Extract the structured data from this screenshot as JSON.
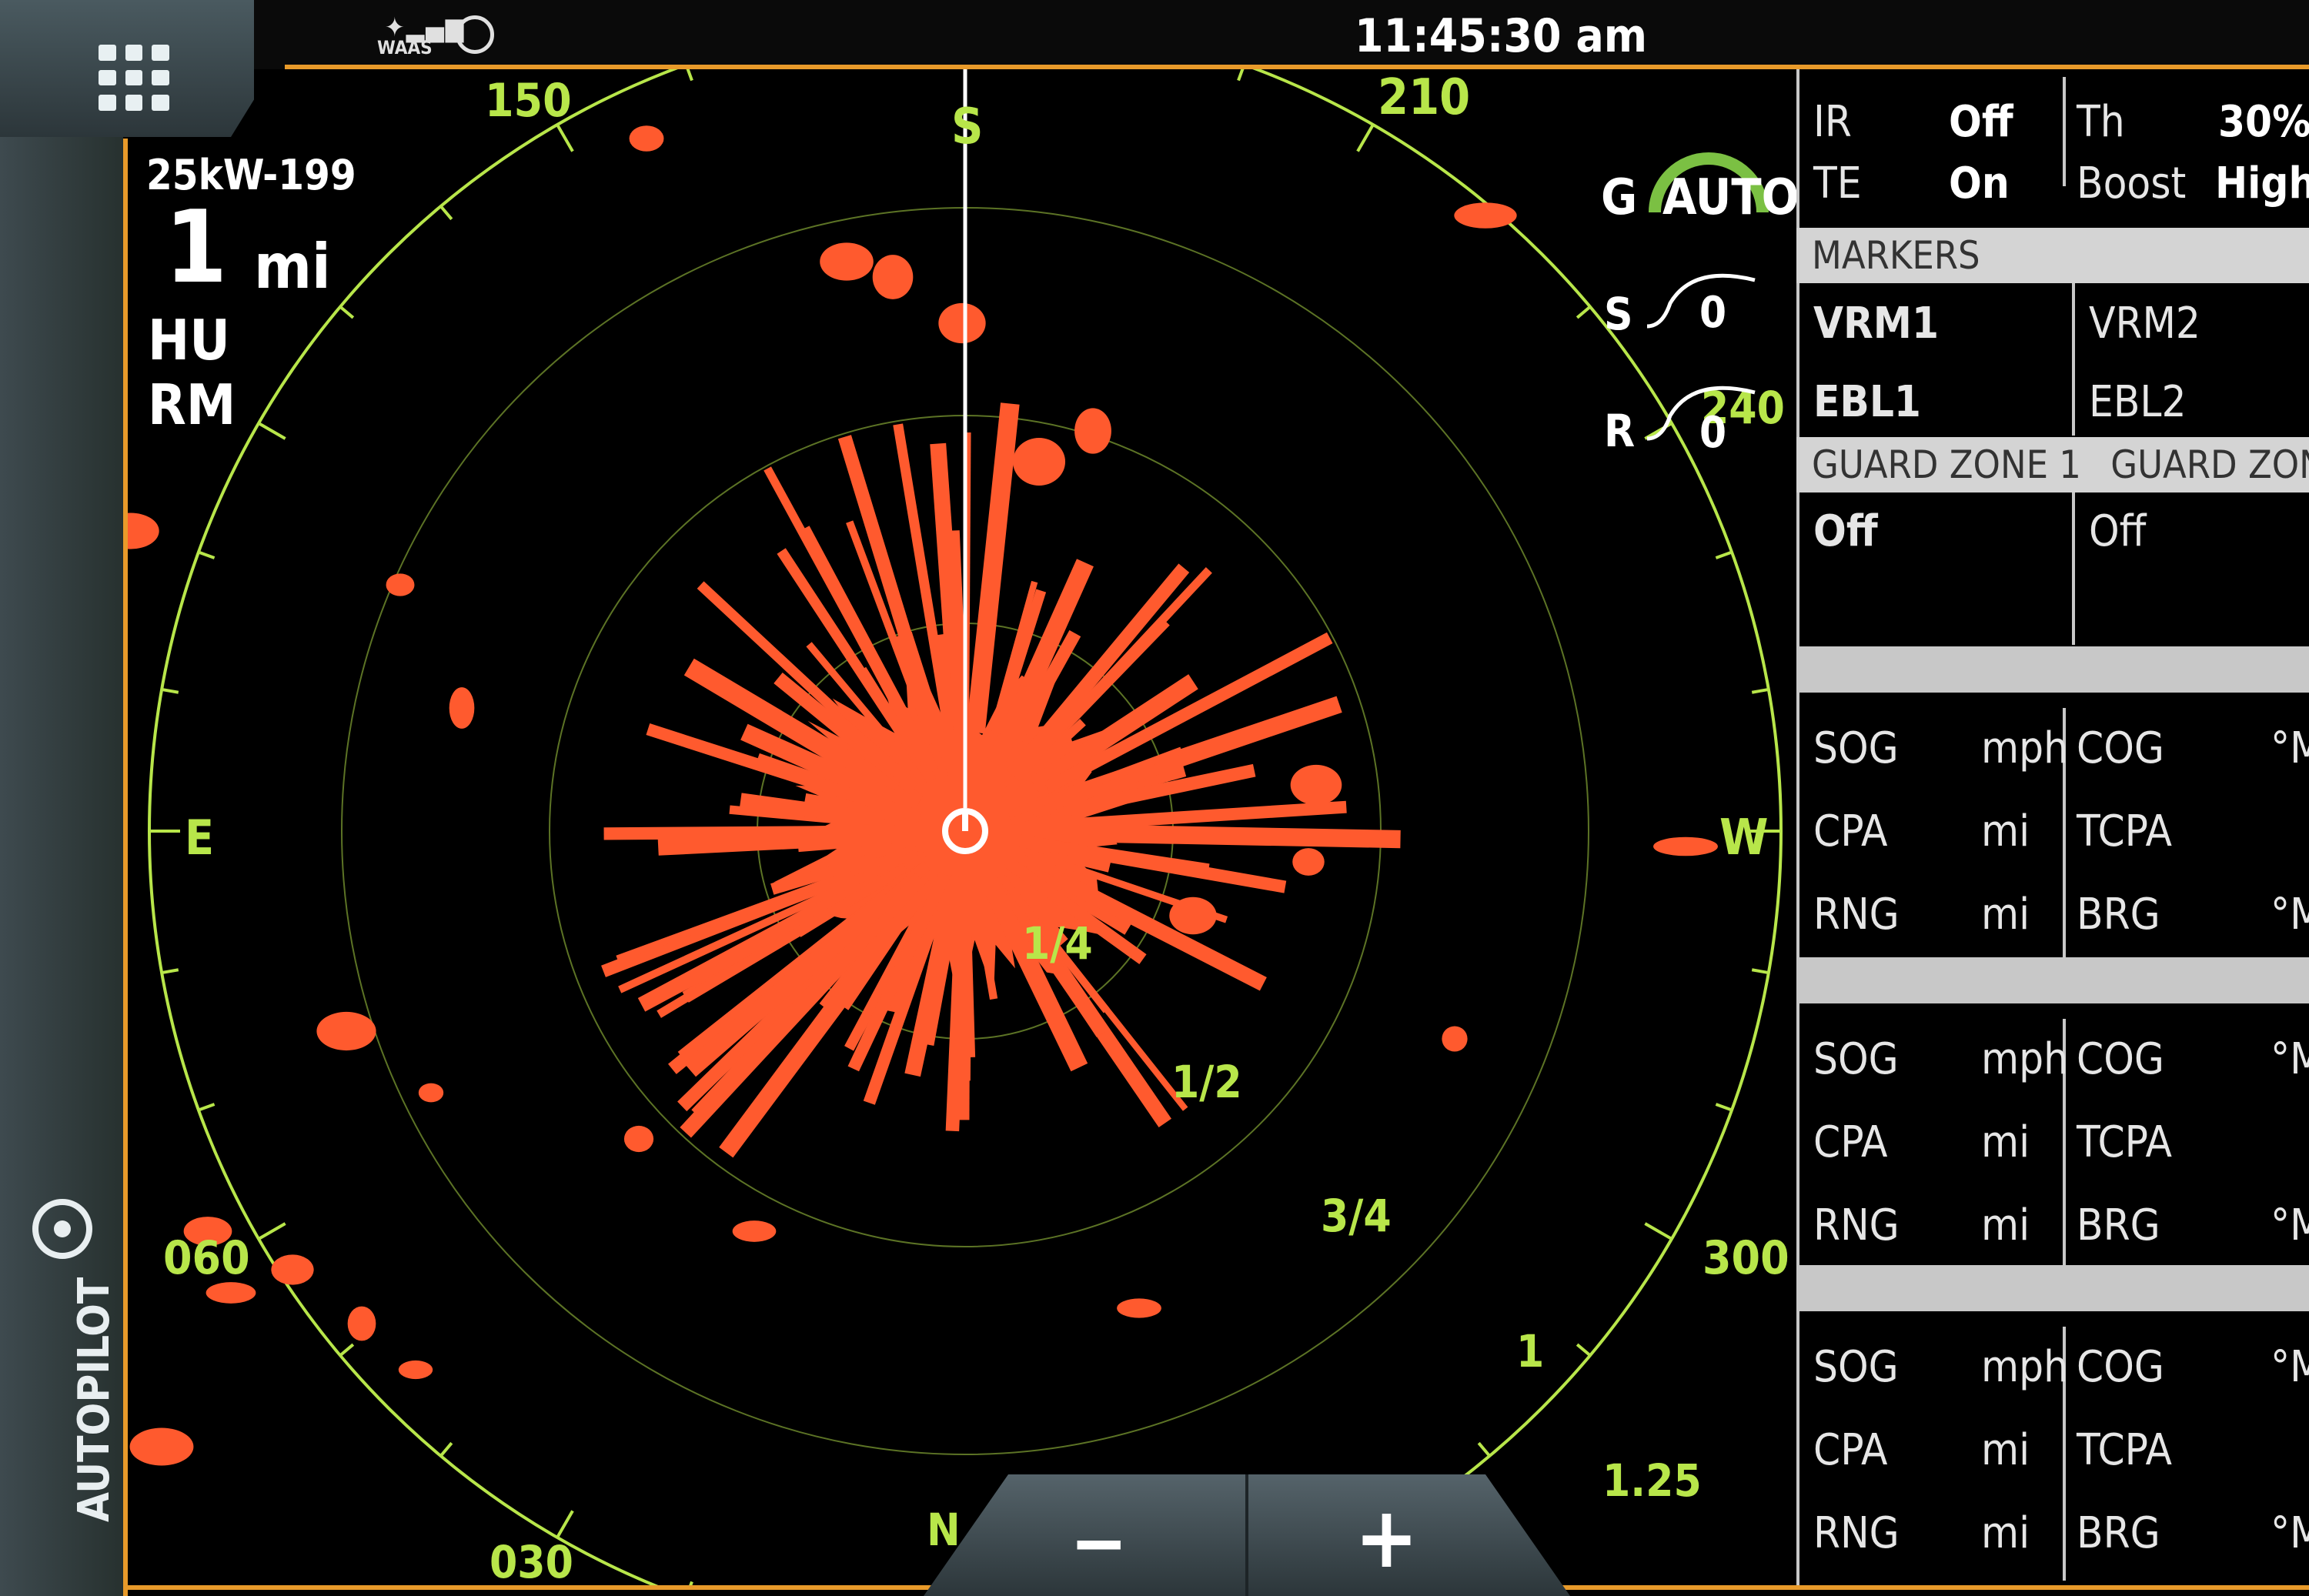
{
  "status_bar": {
    "waas_label": "WAAS",
    "time": "11:45:30 am",
    "home_icon": "grid-menu-icon",
    "gps_icon": "gps-refresh-icon"
  },
  "radar": {
    "model": "25kW-199",
    "range_value": "1",
    "range_unit": "mi",
    "orientation": "HU",
    "motion": "RM",
    "gain_label": "G",
    "gain_mode": "AUTO",
    "sea_label": "S",
    "sea_value": "0",
    "rain_label": "R",
    "rain_value": "0",
    "bearing_labels": [
      {
        "text": "150"
      },
      {
        "text": "S"
      },
      {
        "text": "210"
      },
      {
        "text": "240"
      },
      {
        "text": "W"
      },
      {
        "text": "300"
      },
      {
        "text": "E"
      },
      {
        "text": "060"
      },
      {
        "text": "030"
      },
      {
        "text": "N"
      }
    ],
    "ring_labels": [
      "1/4",
      "1/2",
      "3/4",
      "1",
      "1.25"
    ],
    "colors": {
      "echo": "#ff5a2e",
      "rings": "#b8e64a",
      "frame": "#e89a2a"
    }
  },
  "settings": {
    "ir_label": "IR",
    "ir_value": "Off",
    "th_label": "Th",
    "th_value": "30%",
    "te_label": "TE",
    "te_value": "On",
    "boost_label": "Boost",
    "boost_value": "High"
  },
  "markers": {
    "header": "MARKERS",
    "vrm1": "VRM1",
    "vrm2": "VRM2",
    "ebl1": "EBL1",
    "ebl2": "EBL2"
  },
  "guard_zones": {
    "header_1": "GUARD ZONE 1",
    "header_2": "GUARD ZONE",
    "zone1_value": "Off",
    "zone2_value": "Off"
  },
  "targets": [
    {
      "rows": [
        {
          "left_label": "SOG",
          "left_unit": "mph",
          "right_label": "COG",
          "right_unit": "°M"
        },
        {
          "left_label": "CPA",
          "left_unit": "mi",
          "right_label": "TCPA",
          "right_unit": ""
        },
        {
          "left_label": "RNG",
          "left_unit": "mi",
          "right_label": "BRG",
          "right_unit": "°M"
        }
      ]
    },
    {
      "rows": [
        {
          "left_label": "SOG",
          "left_unit": "mph",
          "right_label": "COG",
          "right_unit": "°M"
        },
        {
          "left_label": "CPA",
          "left_unit": "mi",
          "right_label": "TCPA",
          "right_unit": ""
        },
        {
          "left_label": "RNG",
          "left_unit": "mi",
          "right_label": "BRG",
          "right_unit": "°M"
        }
      ]
    },
    {
      "rows": [
        {
          "left_label": "SOG",
          "left_unit": "mph",
          "right_label": "COG",
          "right_unit": "°M"
        },
        {
          "left_label": "CPA",
          "left_unit": "mi",
          "right_label": "TCPA",
          "right_unit": ""
        },
        {
          "left_label": "RNG",
          "left_unit": "mi",
          "right_label": "BRG",
          "right_unit": "°M"
        }
      ]
    }
  ],
  "sidebar": {
    "autopilot_label": "AUTOPILOT",
    "autopilot_icon": "steering-wheel-icon"
  },
  "zoom": {
    "minus": "−",
    "plus": "+"
  }
}
